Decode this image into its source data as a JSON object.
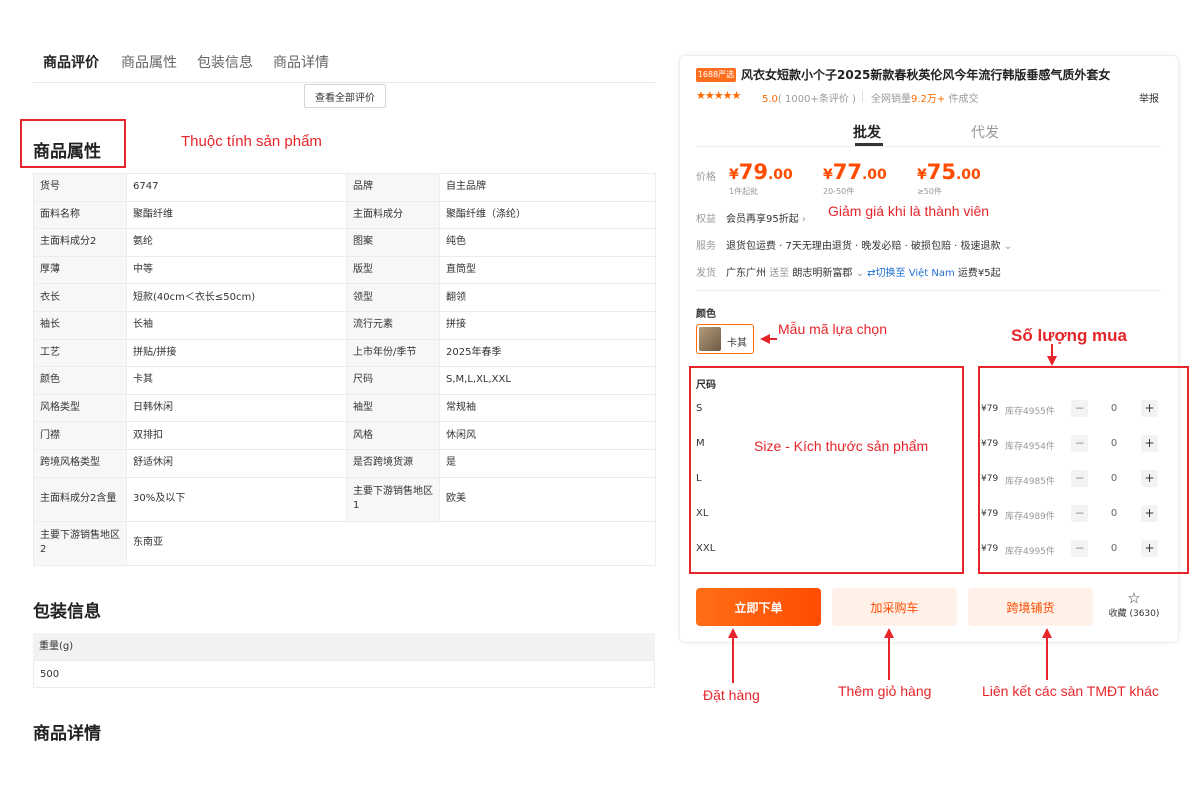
{
  "tabs": [
    "商品评价",
    "商品属性",
    "包装信息",
    "商品详情"
  ],
  "view_all": "查看全部评价",
  "attr_section": {
    "title": "商品属性",
    "annotation": "Thuộc tính sản phẩm"
  },
  "attributes": [
    [
      "货号",
      "6747",
      "品牌",
      "自主品牌"
    ],
    [
      "面料名称",
      "聚酯纤维",
      "主面料成分",
      "聚酯纤维（涤纶）"
    ],
    [
      "主面料成分2",
      "氨纶",
      "图案",
      "纯色"
    ],
    [
      "厚薄",
      "中等",
      "版型",
      "直筒型"
    ],
    [
      "衣长",
      "短款(40cm＜衣长≤50cm)",
      "领型",
      "翻领"
    ],
    [
      "袖长",
      "长袖",
      "流行元素",
      "拼接"
    ],
    [
      "工艺",
      "拼贴/拼接",
      "上市年份/季节",
      "2025年春季"
    ],
    [
      "颜色",
      "卡其",
      "尺码",
      "S,M,L,XL,XXL"
    ],
    [
      "风格类型",
      "日韩休闲",
      "袖型",
      "常规袖"
    ],
    [
      "门襟",
      "双排扣",
      "风格",
      "休闲风"
    ],
    [
      "跨境风格类型",
      "舒适休闲",
      "是否跨境货源",
      "是"
    ],
    [
      "主面料成分2含量",
      "30%及以下",
      "主要下游销售地区1",
      "欧美"
    ],
    [
      "主要下游销售地区2",
      "东南亚"
    ]
  ],
  "packaging": {
    "title": "包装信息",
    "header": "重量(g)",
    "value": "500"
  },
  "details_title": "商品详情",
  "product": {
    "badge": "1688严选",
    "title": "风衣女短款小个子2025新款春秋英伦风今年流行韩版垂感气质外套女",
    "stars": "★★★★★",
    "rating": "5.0",
    "reviews": "( 1000+条评价 )",
    "sales_label": "全网销量",
    "sales_num": "9.2万+",
    "sales_suffix": " 件成交",
    "report": "举报"
  },
  "mode_tabs": {
    "active": "批发",
    "inactive": "代发"
  },
  "price": {
    "label": "价格",
    "tiers": [
      {
        "int": "79",
        "dec": ".00",
        "cond": "1件起批"
      },
      {
        "int": "77",
        "dec": ".00",
        "cond": "20-50件"
      },
      {
        "int": "75",
        "dec": ".00",
        "cond": "≥50件"
      }
    ]
  },
  "rights": {
    "label": "权益",
    "text": "会员再享95折起",
    "annotation": "Giảm giá khi là thành viên"
  },
  "service": {
    "label": "服务",
    "text": "退货包运费 · 7天无理由退货 · 晚发必赔 · 破损包赔 · 极速退款"
  },
  "shipping": {
    "label": "发货",
    "from": "广东广州",
    "to_word": "送至",
    "to": "朗志明新富郡",
    "switch": "切换至 Việt Nam",
    "fee": "运费¥5起"
  },
  "color": {
    "label": "颜色",
    "option": "卡其",
    "annotation": "Mẫu mã lựa chọn"
  },
  "size": {
    "label": "尺码",
    "annotation": "Size - Kích thước sản phẩm"
  },
  "qty_annotation": "Số lượng mua",
  "sizes": [
    {
      "name": "S",
      "price": "¥79",
      "stock": "库存4955件",
      "qty": "0"
    },
    {
      "name": "M",
      "price": "¥79",
      "stock": "库存4954件",
      "qty": "0"
    },
    {
      "name": "L",
      "price": "¥79",
      "stock": "库存4985件",
      "qty": "0"
    },
    {
      "name": "XL",
      "price": "¥79",
      "stock": "库存4989件",
      "qty": "0"
    },
    {
      "name": "XXL",
      "price": "¥79",
      "stock": "库存4995件",
      "qty": "0"
    }
  ],
  "actions": {
    "buy": "立即下单",
    "cart": "加采购车",
    "cross": "跨境铺货",
    "fav": "收藏 (3630)"
  },
  "annotations": {
    "buy": "Đặt hàng",
    "cart": "Thêm giỏ hàng",
    "cross": "Liên kết các sàn TMĐT khác"
  },
  "colors": {
    "accent": "#ff5a00",
    "annotation": "#e5252a"
  }
}
